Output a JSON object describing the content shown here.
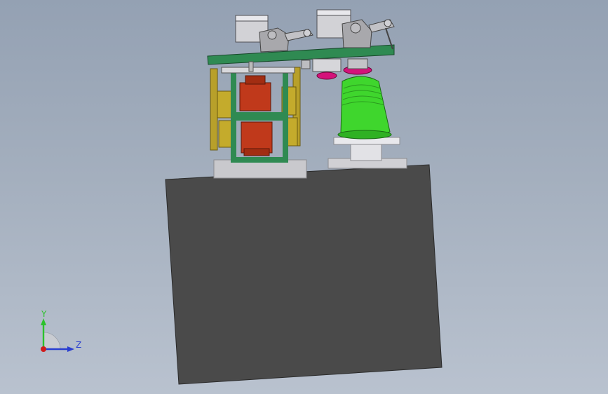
{
  "viewport": {
    "background_top": "#94a1b3",
    "background_bottom": "#b9c2cf"
  },
  "model": {
    "base_color": "#4a4a4a",
    "frame_color": "#2f8a52",
    "cylinder_color": "#c0391b",
    "bobbin_color": "#3fd62d",
    "magenta_color": "#d4127a",
    "rail_color": "#b8a02a"
  },
  "triad": {
    "y_label": "Y",
    "z_label": "Z",
    "y_color": "#2cc22c",
    "z_color": "#2a3fd0",
    "x_color": "#d01c1c"
  }
}
